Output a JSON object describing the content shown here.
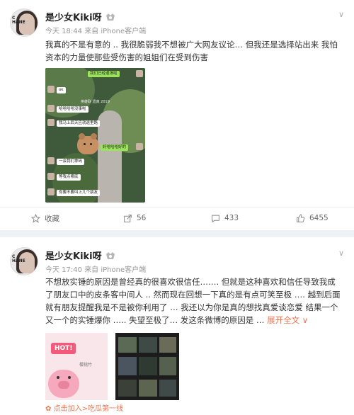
{
  "posts": [
    {
      "username": "是少女Kiki呀",
      "time": "今天 18:44",
      "source": "来自 iPhone客户端",
      "text": "我真的不是有意的 .. 我很脆弱我不想被广大网友议论… 但我还是选择站出来 我怕资本的力量使那些受伤害的姐姐们在受到伤害",
      "chat": {
        "top_bubble": "我们已经退场啦",
        "ok": "ok",
        "date": "英雄联 遗真 2019",
        "b1": "哈哈哈哈没事啦",
        "b2": "我马上后天应就退里路",
        "b3": "好哈哈哈好的",
        "b4": "一会我们拿码",
        "b5": "等我点哪底",
        "b6": "你要不要叫上几个朋友"
      },
      "actions": {
        "favorite": "收藏",
        "share": "56",
        "comment": "433",
        "like": "6455"
      }
    },
    {
      "username": "是少女Kiki呀",
      "time": "今天 17:40",
      "source": "来自 iPhone客户端",
      "text": "不想放实锤的原因是曾经真的很喜欢很信任……. 但就是这种喜欢和信任导致我成了朋友口中的皮条客中间人 .. 然而现在回想一下真的是有点可笑至极 …. 越到后面就有朋友提醒我是不是被你利用了 … 我还以为你是真的想找真爱谈恋爱 结果一个又一个的实锤爆你 ….. 失望至极了… 发这条微博的原因是 …",
      "expand": "展开全文",
      "thumb1": {
        "hot": "HOT!",
        "line": "樱桃竹"
      },
      "footer": "点击加入>吃瓜第一线"
    }
  ],
  "colors": {
    "accent": "#eb7350",
    "divider": "#eef2f6",
    "wechat_green": "#9be35b"
  }
}
